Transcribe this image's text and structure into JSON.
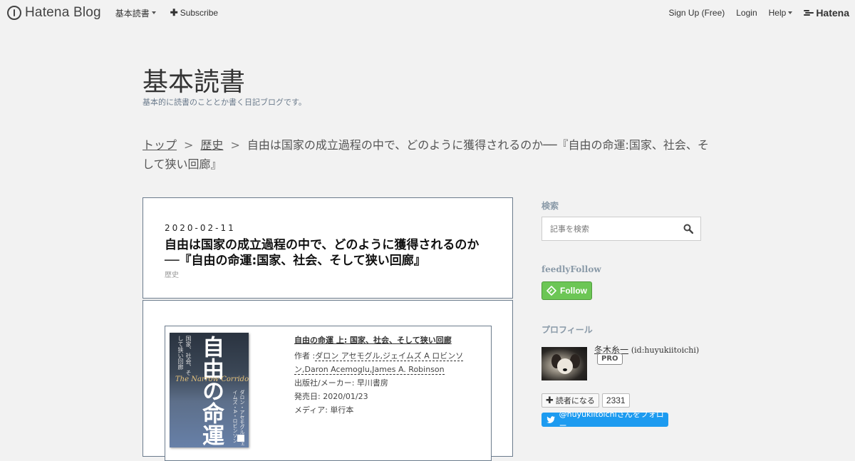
{
  "global_header": {
    "brand": "Hatena Blog",
    "menu_label": "基本読書",
    "subscribe_label": "Subscribe",
    "signup_label": "Sign Up (Free)",
    "login_label": "Login",
    "help_label": "Help",
    "hatena_label": "Hatena"
  },
  "blog": {
    "title": "基本読書",
    "description": "基本的に読書のこととか書く日記ブログです。"
  },
  "breadcrumb": {
    "items": [
      "トップ",
      "歴史"
    ],
    "separator": ">",
    "current": "自由は国家の成立過程の中で、どのように獲得されるのか──『自由の命運:国家、社会、そして狭い回廊』"
  },
  "entry": {
    "date": "2020-02-11",
    "title": "自由は国家の成立過程の中で、どのように獲得されるのか──『自由の命運:国家、社会、そして狭い回廊』",
    "category": "歴史"
  },
  "product": {
    "name": "自由の命運 上: 国家、社会、そして狭い回廊",
    "author_prefix": "作者 :",
    "authors": "ダロン アセモグル,ジェイムズ A ロビンソン,Daron Acemoglu,James A. Robinson",
    "publisher": "出版社/メーカー: 早川書房",
    "release_date": "発売日: 2020/01/23",
    "media": "メディア: 単行本",
    "cover": {
      "title": "自由の命運",
      "subtitle": "国家、社会、そして狭い回廊",
      "en_title": "The Narrow Corridor",
      "authors": "ダロン・アセモグル ジェイムズ・A・ロビンソン"
    }
  },
  "sidebar": {
    "search": {
      "heading": "検索",
      "placeholder": "記事を検索"
    },
    "feedly": {
      "heading": "feedlyFollow",
      "button_label": "Follow"
    },
    "profile": {
      "heading": "プロフィール",
      "name": "冬木糸一",
      "id": "(id:huyukiitoichi)",
      "badge": "PRO"
    },
    "subscribe": {
      "label": "読者になる",
      "count": "2331"
    },
    "twitter": {
      "label": "@huyukiitoichiさんをフォロー"
    }
  }
}
